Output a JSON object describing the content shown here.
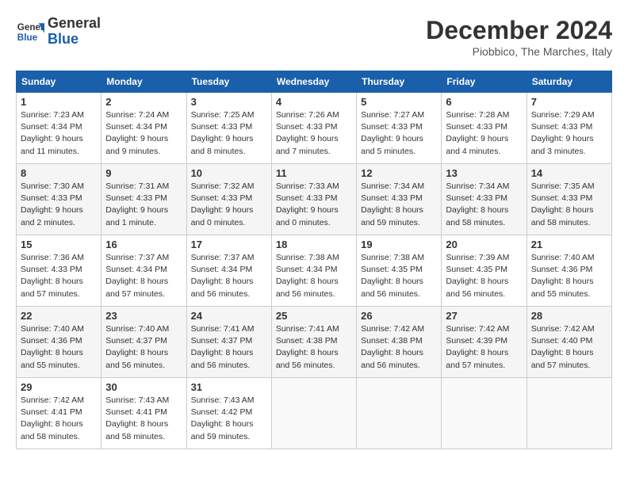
{
  "logo": {
    "line1": "General",
    "line2": "Blue"
  },
  "title": "December 2024",
  "subtitle": "Piobbico, The Marches, Italy",
  "days_of_week": [
    "Sunday",
    "Monday",
    "Tuesday",
    "Wednesday",
    "Thursday",
    "Friday",
    "Saturday"
  ],
  "weeks": [
    [
      {
        "day": "1",
        "info": "Sunrise: 7:23 AM\nSunset: 4:34 PM\nDaylight: 9 hours\nand 11 minutes."
      },
      {
        "day": "2",
        "info": "Sunrise: 7:24 AM\nSunset: 4:34 PM\nDaylight: 9 hours\nand 9 minutes."
      },
      {
        "day": "3",
        "info": "Sunrise: 7:25 AM\nSunset: 4:33 PM\nDaylight: 9 hours\nand 8 minutes."
      },
      {
        "day": "4",
        "info": "Sunrise: 7:26 AM\nSunset: 4:33 PM\nDaylight: 9 hours\nand 7 minutes."
      },
      {
        "day": "5",
        "info": "Sunrise: 7:27 AM\nSunset: 4:33 PM\nDaylight: 9 hours\nand 5 minutes."
      },
      {
        "day": "6",
        "info": "Sunrise: 7:28 AM\nSunset: 4:33 PM\nDaylight: 9 hours\nand 4 minutes."
      },
      {
        "day": "7",
        "info": "Sunrise: 7:29 AM\nSunset: 4:33 PM\nDaylight: 9 hours\nand 3 minutes."
      }
    ],
    [
      {
        "day": "8",
        "info": "Sunrise: 7:30 AM\nSunset: 4:33 PM\nDaylight: 9 hours\nand 2 minutes."
      },
      {
        "day": "9",
        "info": "Sunrise: 7:31 AM\nSunset: 4:33 PM\nDaylight: 9 hours\nand 1 minute."
      },
      {
        "day": "10",
        "info": "Sunrise: 7:32 AM\nSunset: 4:33 PM\nDaylight: 9 hours\nand 0 minutes."
      },
      {
        "day": "11",
        "info": "Sunrise: 7:33 AM\nSunset: 4:33 PM\nDaylight: 9 hours\nand 0 minutes."
      },
      {
        "day": "12",
        "info": "Sunrise: 7:34 AM\nSunset: 4:33 PM\nDaylight: 8 hours\nand 59 minutes."
      },
      {
        "day": "13",
        "info": "Sunrise: 7:34 AM\nSunset: 4:33 PM\nDaylight: 8 hours\nand 58 minutes."
      },
      {
        "day": "14",
        "info": "Sunrise: 7:35 AM\nSunset: 4:33 PM\nDaylight: 8 hours\nand 58 minutes."
      }
    ],
    [
      {
        "day": "15",
        "info": "Sunrise: 7:36 AM\nSunset: 4:33 PM\nDaylight: 8 hours\nand 57 minutes."
      },
      {
        "day": "16",
        "info": "Sunrise: 7:37 AM\nSunset: 4:34 PM\nDaylight: 8 hours\nand 57 minutes."
      },
      {
        "day": "17",
        "info": "Sunrise: 7:37 AM\nSunset: 4:34 PM\nDaylight: 8 hours\nand 56 minutes."
      },
      {
        "day": "18",
        "info": "Sunrise: 7:38 AM\nSunset: 4:34 PM\nDaylight: 8 hours\nand 56 minutes."
      },
      {
        "day": "19",
        "info": "Sunrise: 7:38 AM\nSunset: 4:35 PM\nDaylight: 8 hours\nand 56 minutes."
      },
      {
        "day": "20",
        "info": "Sunrise: 7:39 AM\nSunset: 4:35 PM\nDaylight: 8 hours\nand 56 minutes."
      },
      {
        "day": "21",
        "info": "Sunrise: 7:40 AM\nSunset: 4:36 PM\nDaylight: 8 hours\nand 55 minutes."
      }
    ],
    [
      {
        "day": "22",
        "info": "Sunrise: 7:40 AM\nSunset: 4:36 PM\nDaylight: 8 hours\nand 55 minutes."
      },
      {
        "day": "23",
        "info": "Sunrise: 7:40 AM\nSunset: 4:37 PM\nDaylight: 8 hours\nand 56 minutes."
      },
      {
        "day": "24",
        "info": "Sunrise: 7:41 AM\nSunset: 4:37 PM\nDaylight: 8 hours\nand 56 minutes."
      },
      {
        "day": "25",
        "info": "Sunrise: 7:41 AM\nSunset: 4:38 PM\nDaylight: 8 hours\nand 56 minutes."
      },
      {
        "day": "26",
        "info": "Sunrise: 7:42 AM\nSunset: 4:38 PM\nDaylight: 8 hours\nand 56 minutes."
      },
      {
        "day": "27",
        "info": "Sunrise: 7:42 AM\nSunset: 4:39 PM\nDaylight: 8 hours\nand 57 minutes."
      },
      {
        "day": "28",
        "info": "Sunrise: 7:42 AM\nSunset: 4:40 PM\nDaylight: 8 hours\nand 57 minutes."
      }
    ],
    [
      {
        "day": "29",
        "info": "Sunrise: 7:42 AM\nSunset: 4:41 PM\nDaylight: 8 hours\nand 58 minutes."
      },
      {
        "day": "30",
        "info": "Sunrise: 7:43 AM\nSunset: 4:41 PM\nDaylight: 8 hours\nand 58 minutes."
      },
      {
        "day": "31",
        "info": "Sunrise: 7:43 AM\nSunset: 4:42 PM\nDaylight: 8 hours\nand 59 minutes."
      },
      null,
      null,
      null,
      null
    ]
  ]
}
